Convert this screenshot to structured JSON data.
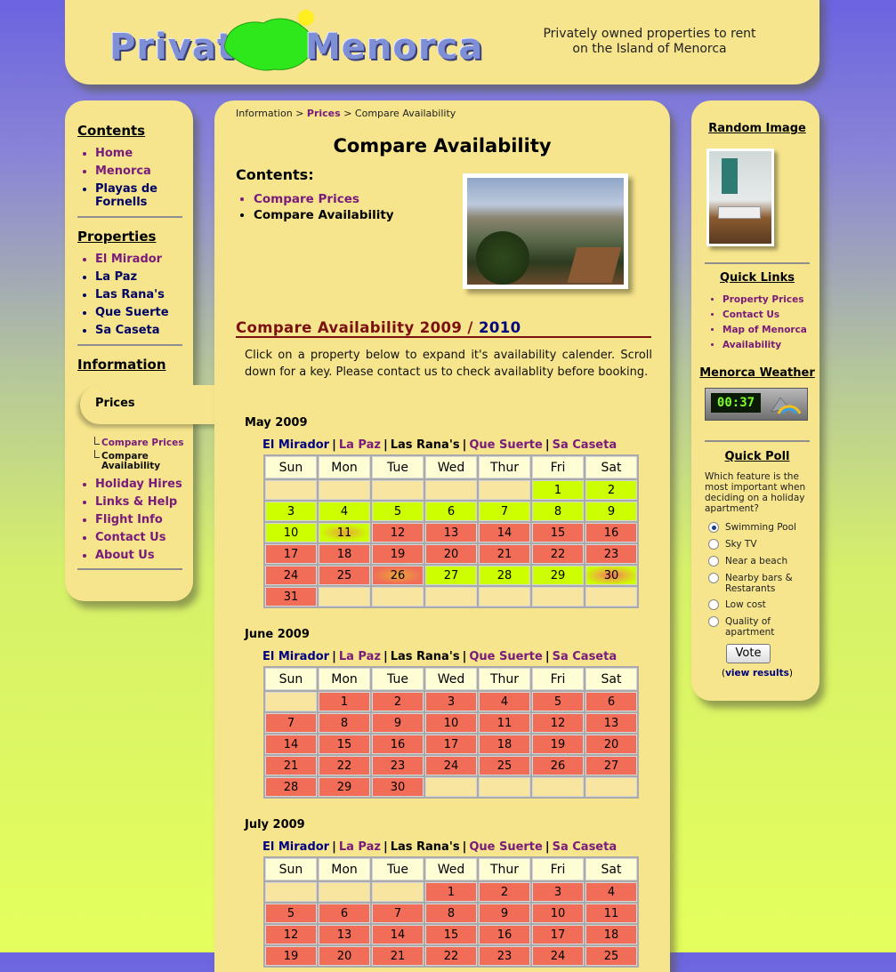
{
  "header": {
    "logo_left": "Private",
    "logo_right": "Menorca",
    "tagline_line1": "Privately owned properties to rent",
    "tagline_line2": "on the Island of Menorca"
  },
  "left_nav": {
    "contents_title": "Contents",
    "contents_items": [
      "Home",
      "Menorca",
      "Playas de Fornells"
    ],
    "properties_title": "Properties",
    "properties_items": [
      "El Mirador",
      "La Paz",
      "Las Rana's",
      "Que Suerte",
      "Sa Caseta"
    ],
    "information_title": "Information",
    "prices_tab": "Prices",
    "prices_sub": [
      "Compare Prices",
      "Compare Availability"
    ],
    "info_items": [
      "Holiday Hires",
      "Links & Help",
      "Flight Info",
      "Contact Us",
      "About Us"
    ]
  },
  "breadcrumb": {
    "part1": "Information",
    "sep": ">",
    "part2": "Prices",
    "part3": "Compare Availability"
  },
  "main": {
    "title": "Compare Availability",
    "contents_label": "Contents:",
    "contents_links": [
      "Compare Prices",
      "Compare Availability"
    ],
    "section_title_a": "Compare Availability 2009 / ",
    "section_title_b": "2010",
    "intro": "Click on a property below to expand it's availability calender. Scroll down for a key. Please contact us to check availablity before booking."
  },
  "property_links": [
    "El Mirador",
    "La Paz",
    "Las Rana's",
    "Que Suerte",
    "Sa Caseta"
  ],
  "weekdays": [
    "Sun",
    "Mon",
    "Tue",
    "Wed",
    "Thur",
    "Fri",
    "Sat"
  ],
  "months": [
    {
      "name": "May 2009",
      "weeks": [
        [
          [
            "",
            "empty"
          ],
          [
            "",
            "empty"
          ],
          [
            "",
            "empty"
          ],
          [
            "",
            "empty"
          ],
          [
            "",
            "empty"
          ],
          [
            "1",
            "free"
          ],
          [
            "2",
            "free"
          ]
        ],
        [
          [
            "3",
            "free"
          ],
          [
            "4",
            "free"
          ],
          [
            "5",
            "free"
          ],
          [
            "6",
            "free"
          ],
          [
            "7",
            "free"
          ],
          [
            "8",
            "free"
          ],
          [
            "9",
            "free"
          ]
        ],
        [
          [
            "10",
            "free"
          ],
          [
            "11",
            "gf"
          ],
          [
            "12",
            "booked"
          ],
          [
            "13",
            "booked"
          ],
          [
            "14",
            "booked"
          ],
          [
            "15",
            "booked"
          ],
          [
            "16",
            "booked"
          ]
        ],
        [
          [
            "17",
            "booked"
          ],
          [
            "18",
            "booked"
          ],
          [
            "19",
            "booked"
          ],
          [
            "20",
            "booked"
          ],
          [
            "21",
            "booked"
          ],
          [
            "22",
            "booked"
          ],
          [
            "23",
            "booked"
          ]
        ],
        [
          [
            "24",
            "booked"
          ],
          [
            "25",
            "booked"
          ],
          [
            "26",
            "gb"
          ],
          [
            "27",
            "free"
          ],
          [
            "28",
            "free"
          ],
          [
            "29",
            "free"
          ],
          [
            "30",
            "g30"
          ]
        ],
        [
          [
            "31",
            "booked"
          ],
          [
            "",
            "empty"
          ],
          [
            "",
            "empty"
          ],
          [
            "",
            "empty"
          ],
          [
            "",
            "empty"
          ],
          [
            "",
            "empty"
          ],
          [
            "",
            "empty"
          ]
        ]
      ]
    },
    {
      "name": "June 2009",
      "weeks": [
        [
          [
            "",
            "empty"
          ],
          [
            "1",
            "booked"
          ],
          [
            "2",
            "booked"
          ],
          [
            "3",
            "booked"
          ],
          [
            "4",
            "booked"
          ],
          [
            "5",
            "booked"
          ],
          [
            "6",
            "booked"
          ]
        ],
        [
          [
            "7",
            "booked"
          ],
          [
            "8",
            "booked"
          ],
          [
            "9",
            "booked"
          ],
          [
            "10",
            "booked"
          ],
          [
            "11",
            "booked"
          ],
          [
            "12",
            "booked"
          ],
          [
            "13",
            "booked"
          ]
        ],
        [
          [
            "14",
            "booked"
          ],
          [
            "15",
            "booked"
          ],
          [
            "16",
            "booked"
          ],
          [
            "17",
            "booked"
          ],
          [
            "18",
            "booked"
          ],
          [
            "19",
            "booked"
          ],
          [
            "20",
            "booked"
          ]
        ],
        [
          [
            "21",
            "booked"
          ],
          [
            "22",
            "booked"
          ],
          [
            "23",
            "booked"
          ],
          [
            "24",
            "booked"
          ],
          [
            "25",
            "booked"
          ],
          [
            "26",
            "booked"
          ],
          [
            "27",
            "booked"
          ]
        ],
        [
          [
            "28",
            "booked"
          ],
          [
            "29",
            "booked"
          ],
          [
            "30",
            "booked"
          ],
          [
            "",
            "empty"
          ],
          [
            "",
            "empty"
          ],
          [
            "",
            "empty"
          ],
          [
            "",
            "empty"
          ]
        ]
      ]
    },
    {
      "name": "July 2009",
      "weeks": [
        [
          [
            "",
            "empty"
          ],
          [
            "",
            "empty"
          ],
          [
            "",
            "empty"
          ],
          [
            "1",
            "booked"
          ],
          [
            "2",
            "booked"
          ],
          [
            "3",
            "booked"
          ],
          [
            "4",
            "booked"
          ]
        ],
        [
          [
            "5",
            "booked"
          ],
          [
            "6",
            "booked"
          ],
          [
            "7",
            "booked"
          ],
          [
            "8",
            "booked"
          ],
          [
            "9",
            "booked"
          ],
          [
            "10",
            "booked"
          ],
          [
            "11",
            "booked"
          ]
        ],
        [
          [
            "12",
            "booked"
          ],
          [
            "13",
            "booked"
          ],
          [
            "14",
            "booked"
          ],
          [
            "15",
            "booked"
          ],
          [
            "16",
            "booked"
          ],
          [
            "17",
            "booked"
          ],
          [
            "18",
            "booked"
          ]
        ],
        [
          [
            "19",
            "booked"
          ],
          [
            "20",
            "booked"
          ],
          [
            "21",
            "booked"
          ],
          [
            "22",
            "booked"
          ],
          [
            "23",
            "booked"
          ],
          [
            "24",
            "booked"
          ],
          [
            "25",
            "booked"
          ]
        ]
      ]
    }
  ],
  "colors": {
    "available": "#ccff00",
    "booked": "#f26d57",
    "empty": "#f7e5a0",
    "panel": "#f6e58c"
  },
  "right": {
    "random_image_title": "Random Image",
    "quick_links_title": "Quick Links",
    "quick_links": [
      "Property Prices",
      "Contact Us",
      "Map of Menorca",
      "Availability"
    ],
    "weather_title": "Menorca Weather",
    "weather_time": "00:37",
    "poll_title": "Quick Poll",
    "poll_question": "Which feature is the most important when deciding on a holiday apartment?",
    "poll_options": [
      "Swimming Pool",
      "Sky TV",
      "Near a beach",
      "Nearby bars & Restarants",
      "Low cost",
      "Quality of apartment"
    ],
    "poll_selected": "Swimming Pool",
    "vote_label": "Vote",
    "results_open": "(",
    "results_link": "view results",
    "results_close": ")"
  }
}
